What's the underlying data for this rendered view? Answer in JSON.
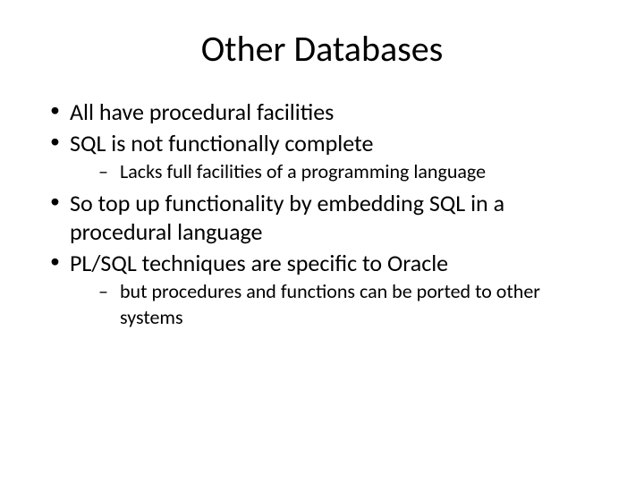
{
  "slide": {
    "title": "Other Databases",
    "bullets": [
      {
        "text": "All have procedural facilities"
      },
      {
        "text": "SQL is not functionally complete",
        "sub": [
          {
            "text": "Lacks full facilities of a programming language"
          }
        ]
      },
      {
        "text": "So top up functionality by embedding SQL in a procedural language"
      },
      {
        "text": "PL/SQL techniques are specific to Oracle",
        "sub": [
          {
            "text": " but procedures and functions can be ported to other systems"
          }
        ]
      }
    ]
  }
}
